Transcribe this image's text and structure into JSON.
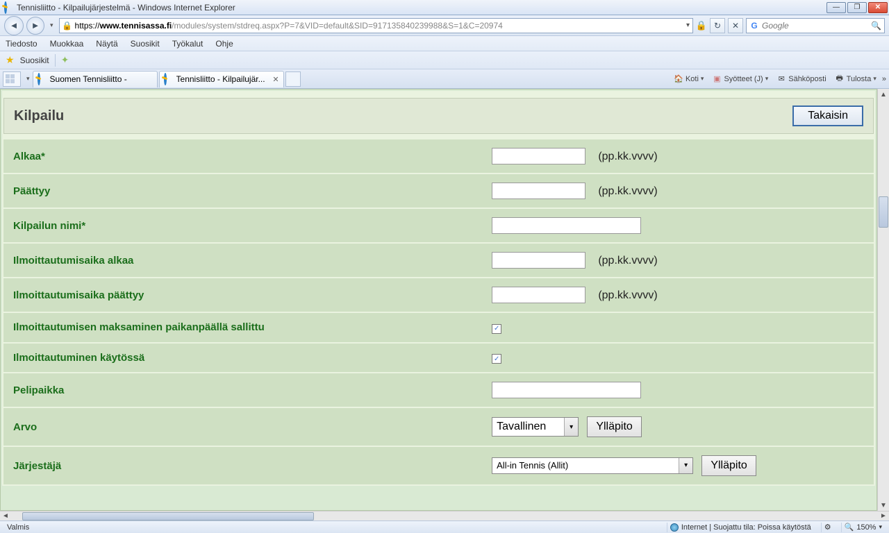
{
  "window": {
    "title": "Tennisliitto - Kilpailujärjestelmä - Windows Internet Explorer"
  },
  "nav": {
    "url_https": "https://",
    "url_host": "www.tennisassa.fi",
    "url_path": "/modules/system/stdreq.aspx?P=7&VID=default&SID=917135840239988&S=1&C=20974",
    "search_placeholder": "Google"
  },
  "menu": [
    "Tiedosto",
    "Muokkaa",
    "Näytä",
    "Suosikit",
    "Työkalut",
    "Ohje"
  ],
  "favbar": {
    "label": "Suosikit"
  },
  "tabs": [
    {
      "title": "Suomen Tennisliitto -",
      "active": false
    },
    {
      "title": "Tennisliitto - Kilpailujär...",
      "active": true
    }
  ],
  "cmdbar": {
    "home": "Koti",
    "feeds": "Syötteet (J)",
    "mail": "Sähköposti",
    "print": "Tulosta"
  },
  "page": {
    "heading": "Kilpailu",
    "back": "Takaisin",
    "rows": {
      "alkaa": {
        "label": "Alkaa*",
        "value": "",
        "hint": "(pp.kk.vvvv)"
      },
      "paattyy": {
        "label": "Päättyy",
        "value": "",
        "hint": "(pp.kk.vvvv)"
      },
      "nimi": {
        "label": "Kilpailun nimi*",
        "value": ""
      },
      "ilmo_alkaa": {
        "label": "Ilmoittautumisaika alkaa",
        "value": "",
        "hint": "(pp.kk.vvvv)"
      },
      "ilmo_paattyy": {
        "label": "Ilmoittautumisaika päättyy",
        "value": "",
        "hint": "(pp.kk.vvvv)"
      },
      "maksu_paikanpaalla": {
        "label": "Ilmoittautumisen maksaminen paikanpäällä sallittu",
        "checked": true
      },
      "ilmo_kaytossa": {
        "label": "Ilmoittautuminen käytössä",
        "checked": true
      },
      "pelipaikka": {
        "label": "Pelipaikka",
        "value": ""
      },
      "arvo": {
        "label": "Arvo",
        "selected": "Tavallinen",
        "maint": "Ylläpito"
      },
      "jarjestaja": {
        "label": "Järjestäjä",
        "selected": "All-in Tennis   (Allit)",
        "maint": "Ylläpito"
      }
    }
  },
  "status": {
    "left": "Valmis",
    "security": "Internet | Suojattu tila: Poissa käytöstä",
    "zoom": "150%"
  }
}
